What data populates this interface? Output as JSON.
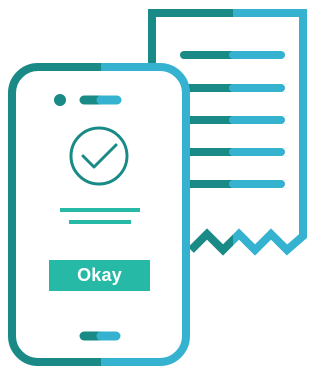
{
  "illustration": {
    "button": {
      "label": "Okay",
      "icon": "check-circle-icon"
    },
    "colors": {
      "dark_teal": "#198a86",
      "light_blue": "#35b2cf",
      "button_fill": "#26b9a6",
      "white": "#ffffff"
    }
  }
}
